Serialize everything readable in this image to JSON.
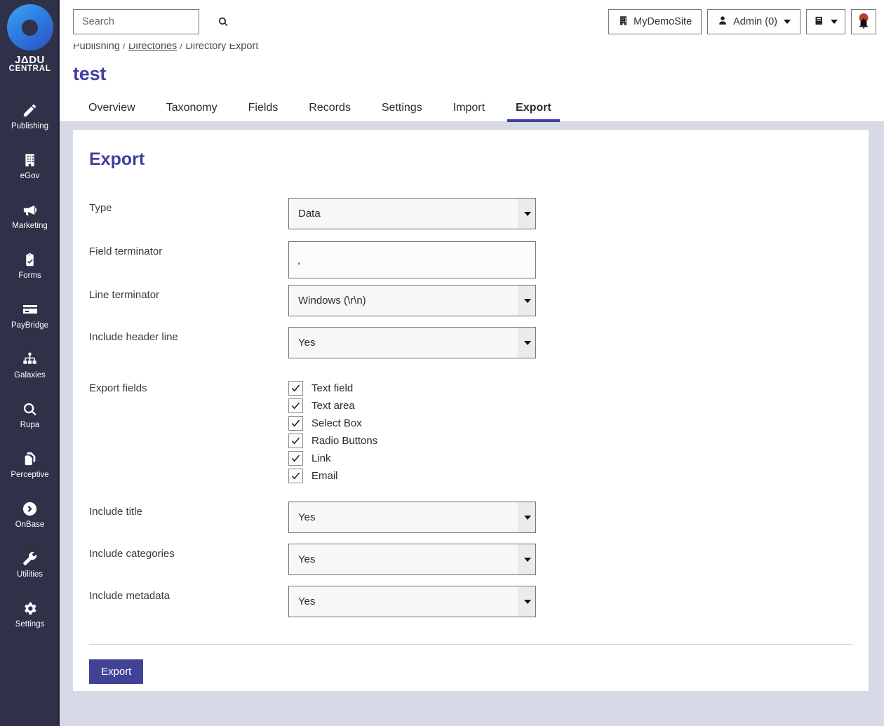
{
  "brand": {
    "logo_line1": "JΔDU",
    "logo_line2": "CENTRAL",
    "logo_icon": "jadu-ring-logo"
  },
  "sidebar": {
    "items": [
      {
        "label": "Publishing",
        "icon": "pencil-icon"
      },
      {
        "label": "eGov",
        "icon": "building-icon"
      },
      {
        "label": "Marketing",
        "icon": "megaphone-icon"
      },
      {
        "label": "Forms",
        "icon": "clipboard-check-icon"
      },
      {
        "label": "PayBridge",
        "icon": "credit-card-icon"
      },
      {
        "label": "Galaxies",
        "icon": "sitemap-icon"
      },
      {
        "label": "Rupa",
        "icon": "magnifier-icon"
      },
      {
        "label": "Perceptive",
        "icon": "copy-documents-icon"
      },
      {
        "label": "OnBase",
        "icon": "chevron-circle-right-icon"
      },
      {
        "label": "Utilities",
        "icon": "wrench-icon"
      },
      {
        "label": "Settings",
        "icon": "gear-icon"
      }
    ]
  },
  "topbar": {
    "search": {
      "value": "",
      "placeholder": "Search",
      "icon": "search-icon"
    },
    "site_button": {
      "label": "MyDemoSite",
      "icon": "building-icon"
    },
    "user_button": {
      "label": "Admin (0)",
      "icon": "user-icon",
      "caret": "chevron-down-icon"
    },
    "book_button": {
      "icon": "book-icon",
      "caret": "chevron-down-icon"
    },
    "notifications_button": {
      "icon": "bell-icon",
      "badge_color": "#c0392b"
    }
  },
  "breadcrumb": {
    "item1": "Publishing",
    "sep1": "/",
    "item2": "Directories",
    "sep2": "/",
    "item3": "Directory Export"
  },
  "page": {
    "title": "test",
    "title_color": "#3f3fa0"
  },
  "tabs": [
    {
      "label": "Overview",
      "active": false
    },
    {
      "label": "Taxonomy",
      "active": false
    },
    {
      "label": "Fields",
      "active": false
    },
    {
      "label": "Records",
      "active": false
    },
    {
      "label": "Settings",
      "active": false
    },
    {
      "label": "Import",
      "active": false
    },
    {
      "label": "Export",
      "active": true
    }
  ],
  "card": {
    "heading": "Export",
    "fields": {
      "type": {
        "label": "Type",
        "value": "Data"
      },
      "field_terminator": {
        "label": "Field terminator",
        "value": ","
      },
      "line_terminator": {
        "label": "Line terminator",
        "value": "Windows (\\r\\n)"
      },
      "include_header_line": {
        "label": "Include header line",
        "value": "Yes"
      },
      "export_fields": {
        "label": "Export fields",
        "options": [
          {
            "label": "Text field",
            "checked": true
          },
          {
            "label": "Text area",
            "checked": true
          },
          {
            "label": "Select Box",
            "checked": true
          },
          {
            "label": "Radio Buttons",
            "checked": true
          },
          {
            "label": "Link",
            "checked": true
          },
          {
            "label": "Email",
            "checked": true
          }
        ]
      },
      "include_title": {
        "label": "Include title",
        "value": "Yes"
      },
      "include_categories": {
        "label": "Include categories",
        "value": "Yes"
      },
      "include_metadata": {
        "label": "Include metadata",
        "value": "Yes"
      }
    },
    "submit_button": {
      "label": "Export",
      "color": "#424296"
    }
  },
  "colors": {
    "sidebar_bg": "#2e3148",
    "page_bg": "#d6d9e6",
    "accent": "#3f3fa0",
    "card_bg": "#ffffff"
  }
}
